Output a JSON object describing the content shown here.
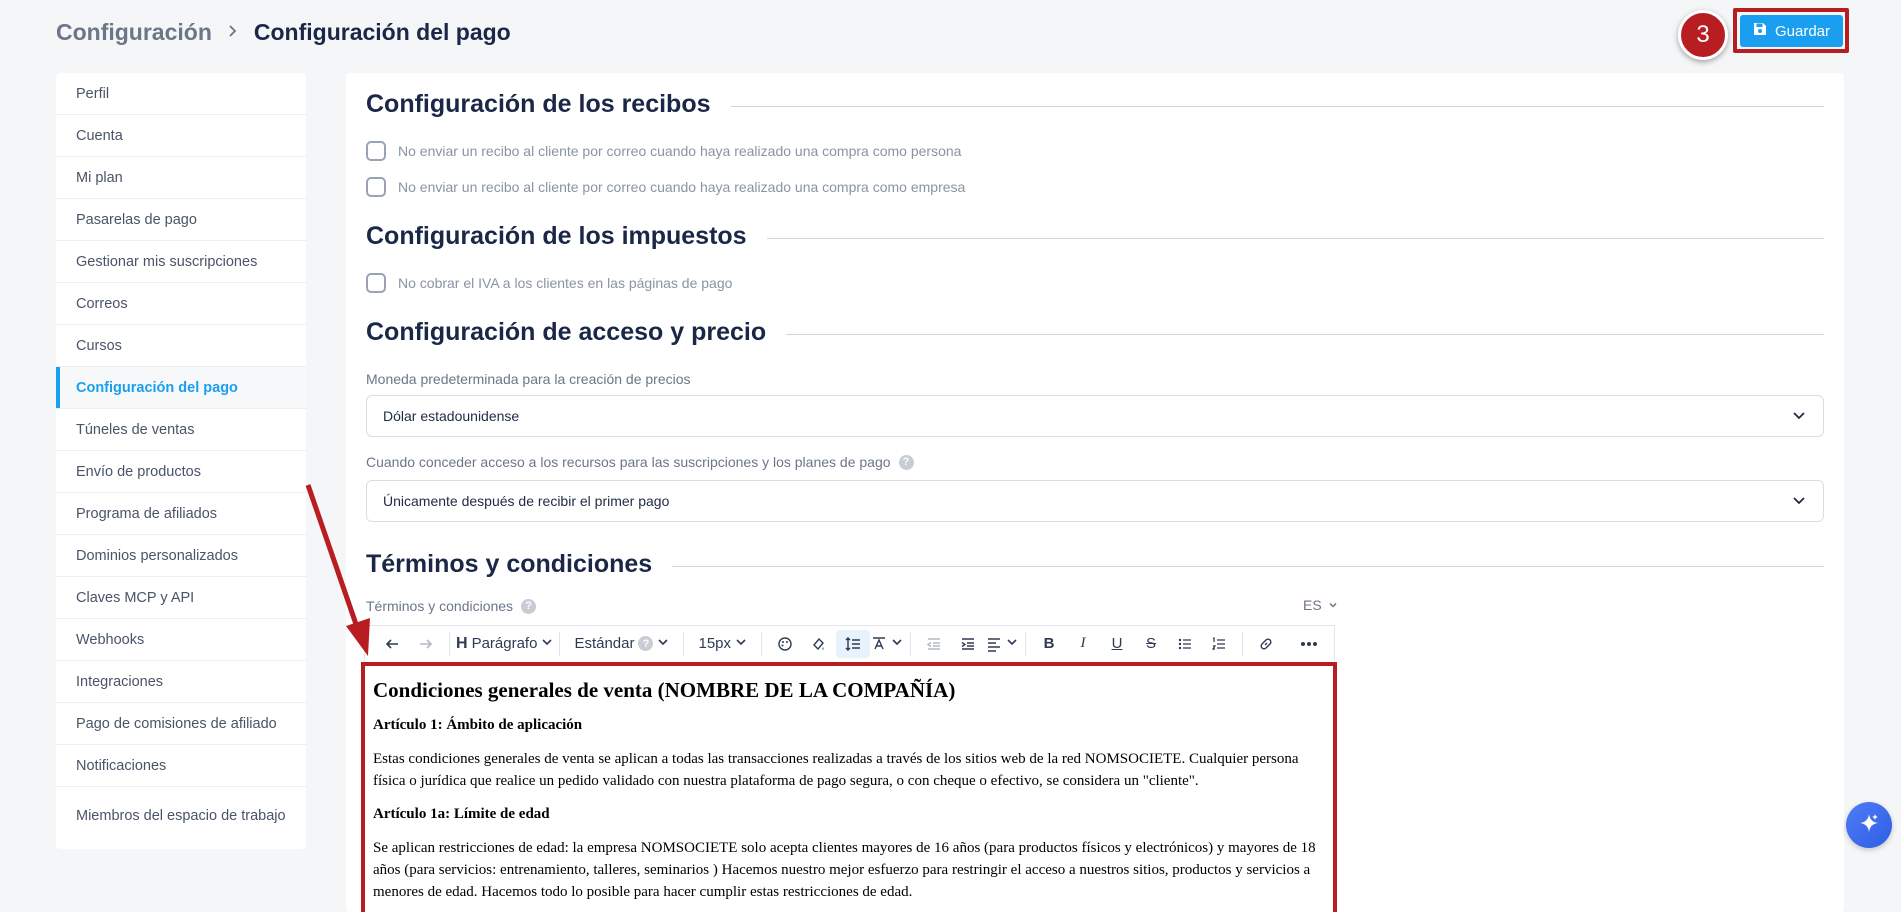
{
  "header": {
    "breadcrumb_parent": "Configuración",
    "breadcrumb_current": "Configuración del pago",
    "step_number": "3",
    "save_label": "Guardar"
  },
  "sidebar": {
    "items": [
      {
        "label": "Perfil"
      },
      {
        "label": "Cuenta"
      },
      {
        "label": "Mi plan"
      },
      {
        "label": "Pasarelas de pago"
      },
      {
        "label": "Gestionar mis suscripciones"
      },
      {
        "label": "Correos"
      },
      {
        "label": "Cursos"
      },
      {
        "label": "Configuración del pago"
      },
      {
        "label": "Túneles de ventas"
      },
      {
        "label": "Envío de productos"
      },
      {
        "label": "Programa de afiliados"
      },
      {
        "label": "Dominios personalizados"
      },
      {
        "label": "Claves MCP y API"
      },
      {
        "label": "Webhooks"
      },
      {
        "label": "Integraciones"
      },
      {
        "label": "Pago de comisiones de afiliado"
      },
      {
        "label": "Notificaciones"
      },
      {
        "label": "Miembros del espacio de trabajo"
      }
    ],
    "active_index": 7
  },
  "receipts": {
    "title": "Configuración de los recibos",
    "option_person": "No enviar un recibo al cliente por correo cuando haya realizado una compra como persona",
    "option_company": "No enviar un recibo al cliente por correo cuando haya realizado una compra como empresa"
  },
  "taxes": {
    "title": "Configuración de los impuestos",
    "option_vat": "No cobrar el IVA a los clientes en las páginas de pago"
  },
  "access": {
    "title": "Configuración de acceso y precio",
    "currency_label": "Moneda predeterminada para la creación de precios",
    "currency_value": "Dólar estadounidense",
    "grant_label": "Cuando conceder acceso a los recursos para las suscripciones y los planes de pago",
    "grant_value": "Únicamente después de recibir el primer pago"
  },
  "terms": {
    "title": "Términos y condiciones",
    "field_label": "Términos y condiciones",
    "language": "ES",
    "toolbar": {
      "heading": "Parágrafo",
      "font": "Estándar",
      "size": "15px"
    },
    "content": {
      "heading": "Condiciones generales de venta (NOMBRE DE LA COMPAÑÍA)",
      "article1_title": "Artículo 1: Ámbito de aplicación",
      "article1_text": "Estas condiciones generales de venta se aplican a todas las transacciones realizadas a través de los sitios web de la red NOMSOCIETE. Cualquier persona física o jurídica que realice un pedido validado con nuestra plataforma de pago segura, o con cheque o efectivo, se considera un \"cliente\".",
      "article1a_title": "Artículo 1a: Límite de edad",
      "article1a_text": "Se aplican restricciones de edad: la empresa NOMSOCIETE solo acepta clientes mayores de 16 años (para productos físicos y electrónicos) y mayores de 18 años (para servicios: entrenamiento, talleres, seminarios ) Hacemos nuestro mejor esfuerzo para restringir el acceso a nuestros sitios, productos y servicios a menores de edad. Hacemos todo lo posible para hacer cumplir estas restricciones de edad."
    }
  },
  "colors": {
    "accent": "#1a9ff0",
    "highlight": "#b81d22",
    "heading": "#1a2747"
  }
}
